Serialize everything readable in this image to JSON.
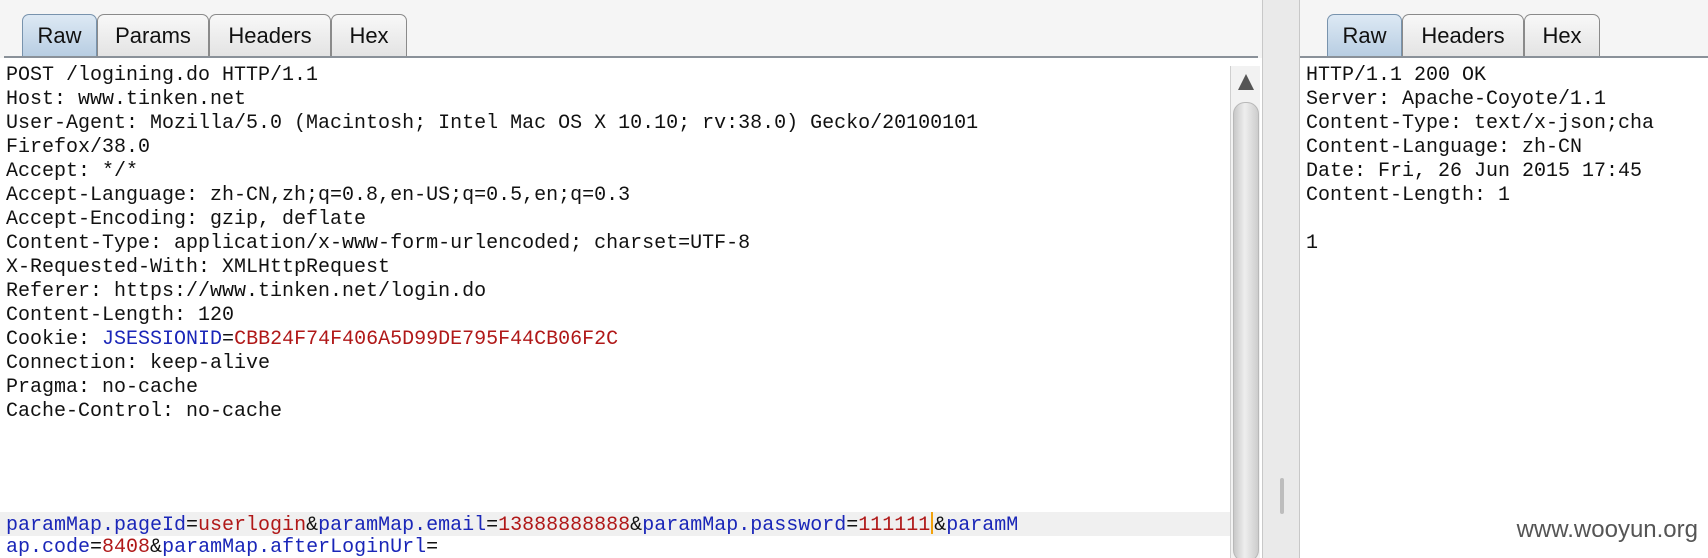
{
  "request_panel": {
    "tabs": [
      "Raw",
      "Params",
      "Headers",
      "Hex"
    ],
    "active_tab": "Raw",
    "headers": [
      "POST /logining.do HTTP/1.1",
      "Host: www.tinken.net",
      "User-Agent: Mozilla/5.0 (Macintosh; Intel Mac OS X 10.10; rv:38.0) Gecko/20100101",
      "Firefox/38.0",
      "Accept: */*",
      "Accept-Language: zh-CN,zh;q=0.8,en-US;q=0.5,en;q=0.3",
      "Accept-Encoding: gzip, deflate",
      "Content-Type: application/x-www-form-urlencoded; charset=UTF-8",
      "X-Requested-With: XMLHttpRequest",
      "Referer: https://www.tinken.net/login.do",
      "Content-Length: 120"
    ],
    "cookie": {
      "prefix": "Cookie: ",
      "name": "JSESSIONID",
      "eq": "=",
      "value": "CBB24F74F406A5D99DE795F44CB06F2C"
    },
    "headers_after_cookie": [
      "Connection: keep-alive",
      "Pragma: no-cache",
      "Cache-Control: no-cache"
    ],
    "body_tokens": {
      "k1": "paramMap.pageId",
      "e1": "=",
      "v1": "userlogin",
      "a1": "&",
      "k2": "paramMap.email",
      "e2": "=",
      "v2": "13888888888",
      "a2": "&",
      "k3": "paramMap.password",
      "e3": "=",
      "v3": "111111",
      "a3": "&",
      "k4a": "paramM",
      "k4b": "ap.code",
      "e4": "=",
      "v4": "8408",
      "a4": "&",
      "k5": "paramMap.afterLoginUrl",
      "e5": "="
    }
  },
  "response_panel": {
    "tabs": [
      "Raw",
      "Headers",
      "Hex"
    ],
    "active_tab": "Raw",
    "lines": [
      "HTTP/1.1 200 OK",
      "Server: Apache-Coyote/1.1",
      "Content-Type: text/x-json;cha",
      "Content-Language: zh-CN",
      "Date: Fri, 26 Jun 2015 17:45",
      "Content-Length: 1",
      "",
      "1"
    ]
  },
  "watermark": "www.wooyun.org",
  "colors": {
    "key": "#1a26b8",
    "value": "#b01818",
    "caret": "#f2a20c",
    "active_tab": "#b7cde2"
  }
}
